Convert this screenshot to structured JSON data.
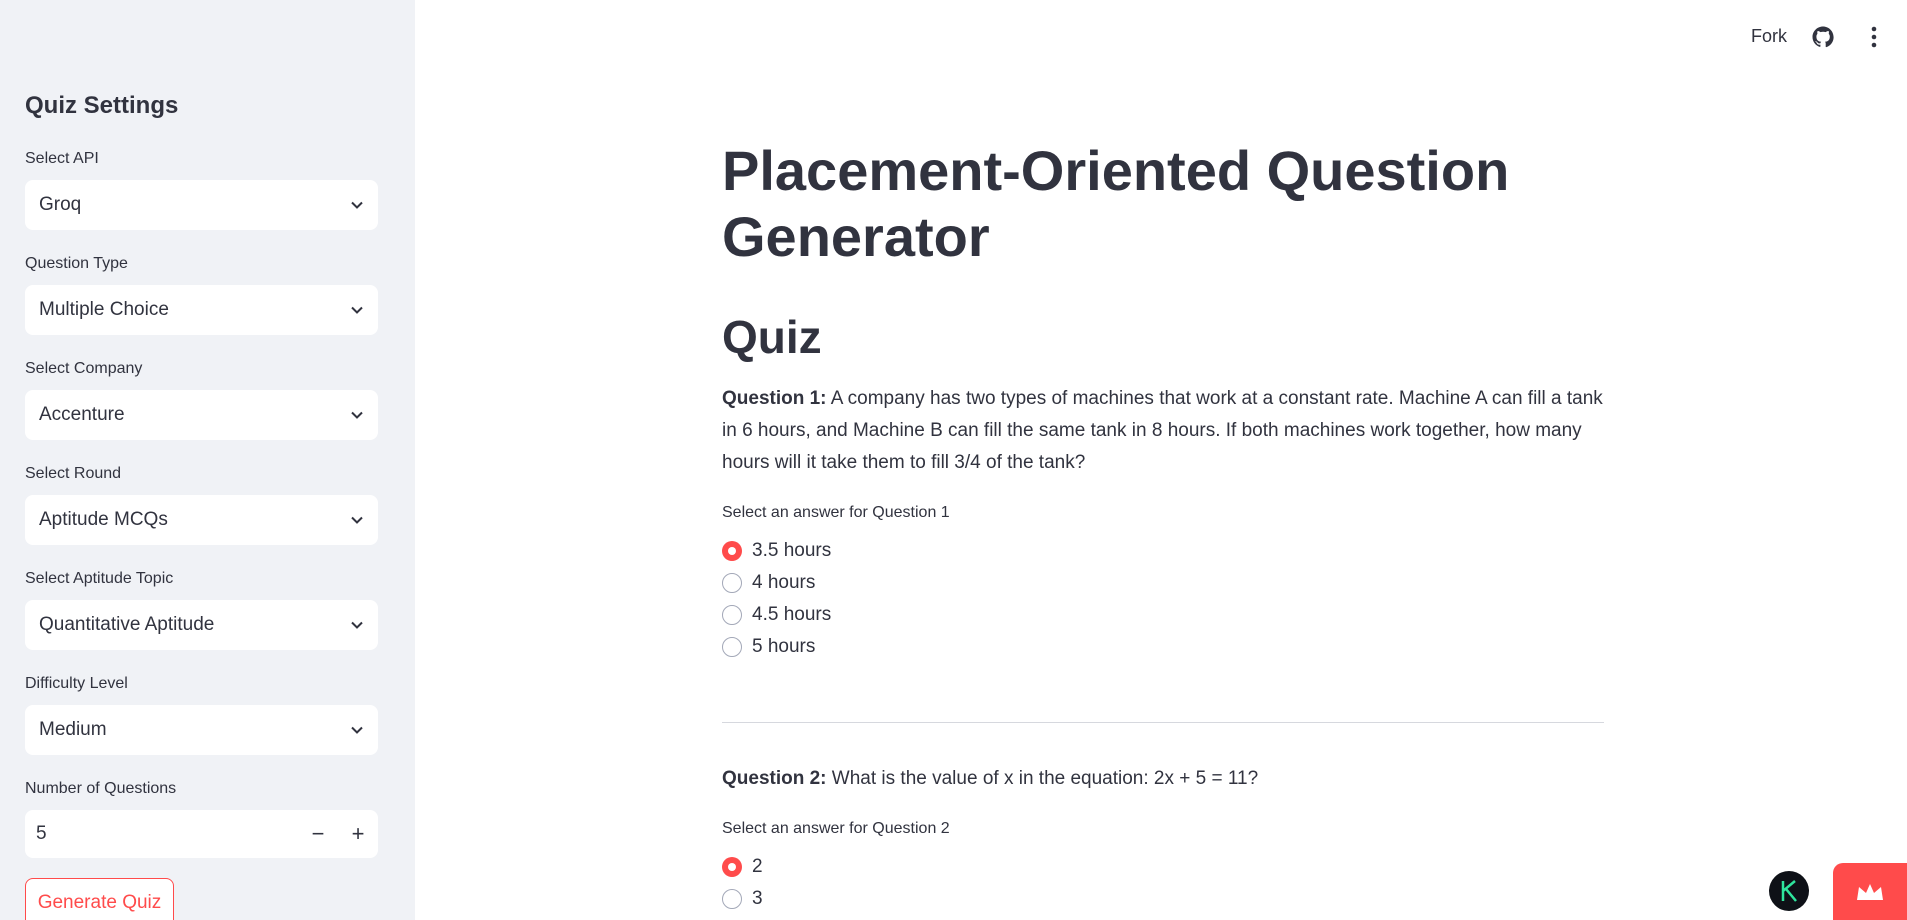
{
  "sidebar": {
    "title": "Quiz Settings",
    "fields": [
      {
        "label": "Select API",
        "value": "Groq"
      },
      {
        "label": "Question Type",
        "value": "Multiple Choice"
      },
      {
        "label": "Select Company",
        "value": "Accenture"
      },
      {
        "label": "Select Round",
        "value": "Aptitude MCQs"
      },
      {
        "label": "Select Aptitude Topic",
        "value": "Quantitative Aptitude"
      },
      {
        "label": "Difficulty Level",
        "value": "Medium"
      }
    ],
    "num_questions": {
      "label": "Number of Questions",
      "value": "5",
      "minus": "−",
      "plus": "+"
    },
    "generate_label": "Generate Quiz"
  },
  "topbar": {
    "fork_label": "Fork",
    "github_icon": "github-icon",
    "menu_icon": "kebab-menu-icon"
  },
  "main": {
    "title": "Placement-Oriented Question Generator",
    "quiz_heading": "Quiz",
    "questions": [
      {
        "prefix": "Question 1:",
        "text": "A company has two types of machines that work at a constant rate. Machine A can fill a tank in 6 hours, and Machine B can fill the same tank in 8 hours. If both machines work together, how many hours will it take them to fill 3/4 of the tank?",
        "radio_label": "Select an answer for Question 1",
        "options": [
          "3.5 hours",
          "4 hours",
          "4.5 hours",
          "5 hours"
        ],
        "selected": 0
      },
      {
        "prefix": "Question 2:",
        "text": "What is the value of x in the equation: 2x + 5 = 11?",
        "radio_label": "Select an answer for Question 2",
        "options": [
          "2",
          "3"
        ],
        "selected": 0
      }
    ]
  },
  "colors": {
    "accent": "#ff4b4b",
    "sidebar_bg": "#f0f2f6",
    "text": "#31333f"
  }
}
